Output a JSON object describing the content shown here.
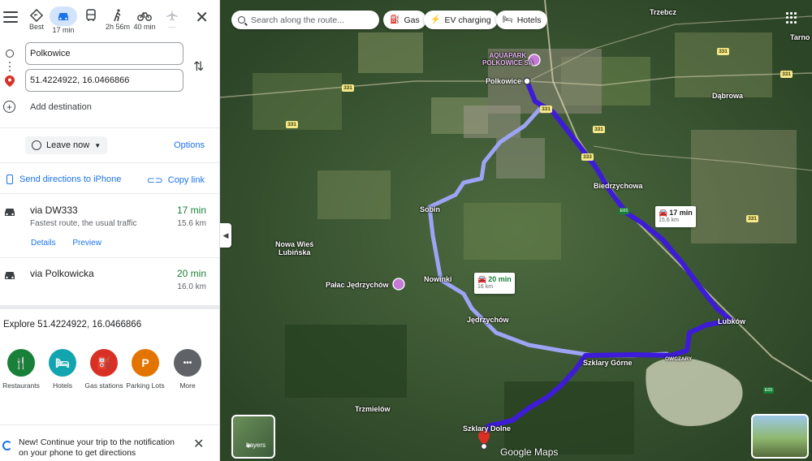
{
  "modes": [
    {
      "id": "best",
      "label": "Best"
    },
    {
      "id": "drive",
      "label": "17 min"
    },
    {
      "id": "transit",
      "label": ""
    },
    {
      "id": "walk",
      "label": "2h 56m"
    },
    {
      "id": "bike",
      "label": "40 min"
    },
    {
      "id": "flight",
      "label": "—"
    }
  ],
  "origin": "Polkowice",
  "destination": "51.4224922, 16.0466866",
  "add_destination": "Add destination",
  "leave_now": "Leave now",
  "options": "Options",
  "send_directions": "Send directions to iPhone",
  "copy_link": "Copy link",
  "routes": [
    {
      "name": "via DW333",
      "desc": "Fastest route, the usual traffic",
      "time": "17 min",
      "dist": "15.6 km",
      "details": "Details",
      "preview": "Preview"
    },
    {
      "name": "via Polkowicka",
      "desc": "",
      "time": "20 min",
      "dist": "16.0 km"
    }
  ],
  "explore_title": "Explore 51.4224922, 16.0466866",
  "categories": [
    {
      "label": "Restaurants",
      "color": "#188038",
      "glyph": "🍴"
    },
    {
      "label": "Hotels",
      "color": "#12a4af",
      "glyph": "🛏"
    },
    {
      "label": "Gas stations",
      "color": "#d93025",
      "glyph": "⛽"
    },
    {
      "label": "Parking Lots",
      "color": "#e37400",
      "glyph": "P"
    },
    {
      "label": "More",
      "color": "#5f6368",
      "glyph": "•••"
    }
  ],
  "notification": "New! Continue your trip to the notification on your phone to get directions",
  "map": {
    "search_placeholder": "Search along the route...",
    "chips": [
      "Gas",
      "EV charging",
      "Hotels"
    ],
    "labels": {
      "aquapark": "AQUAPARK\nPOLKOWICE SA",
      "polkowice": "Polkowice",
      "trzebcz": "Trzebcz",
      "tarno": "Tarno",
      "dabrowa": "Dąbrowa",
      "biedrzychowa": "Biedrzychowa",
      "sobin": "Sobin",
      "nowa_wies": "Nowa Wieś\nLubińska",
      "palac": "Pałac Jędrzychów",
      "nowinki": "Nowinki",
      "jedrzychow": "Jędrzychów",
      "lubkow": "Lubków",
      "owczary": "OWCZARY",
      "szklary_gorne": "Szklary Górne",
      "trzmielow": "Trzmielów",
      "szklary_dolne": "Szklary Dolne"
    },
    "callout_fast": {
      "time": "17 min",
      "dist": "15.6 km"
    },
    "callout_alt": {
      "time": "20 min",
      "dist": "16 km"
    },
    "layers": "Layers",
    "attribution": "Google Maps",
    "route_colors": {
      "primary": "#3d1bd9",
      "alternate": "#9ea4f5"
    }
  }
}
